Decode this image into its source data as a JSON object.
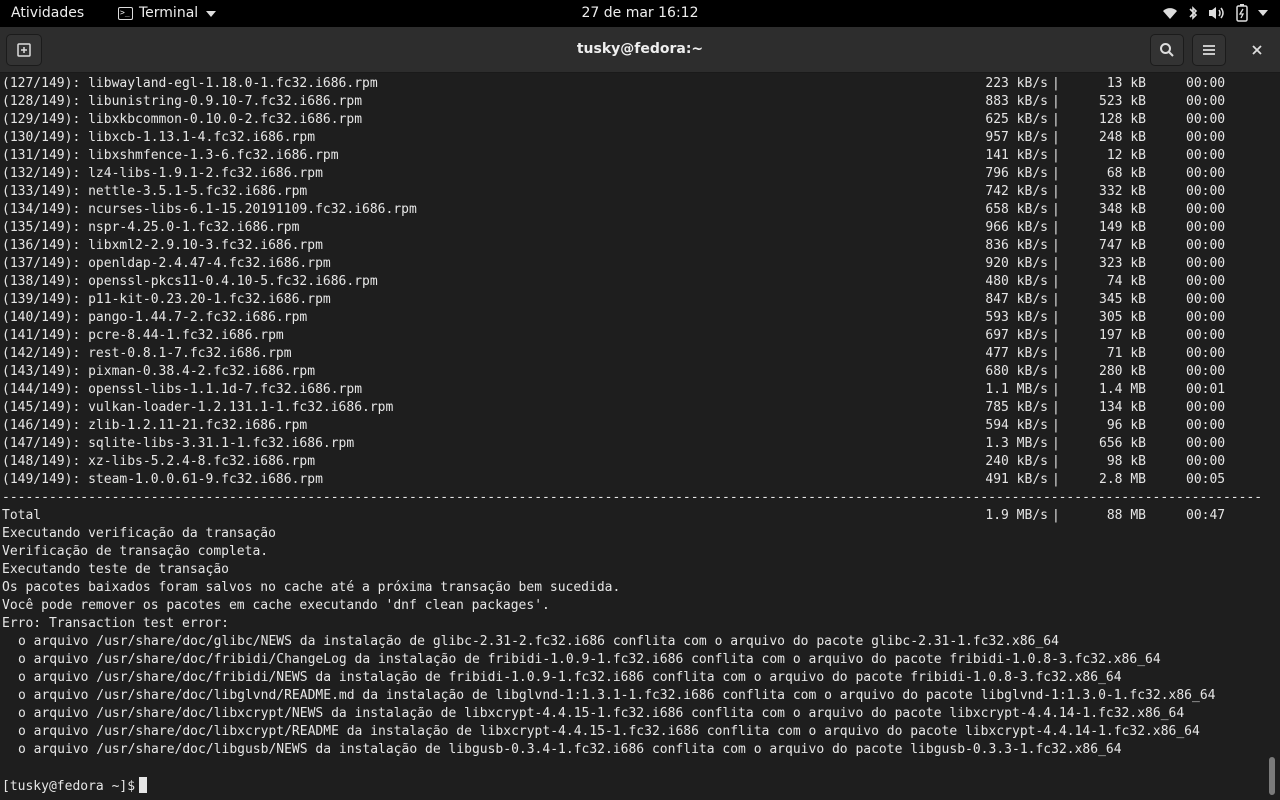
{
  "topbar": {
    "activities": "Atividades",
    "app_name": "Terminal",
    "clock": "27 de mar  16:12",
    "status_icons": [
      "wifi-icon",
      "bluetooth-icon",
      "volume-icon",
      "battery-icon",
      "power-caret-icon"
    ]
  },
  "window": {
    "title": "tusky@fedora:~",
    "buttons": [
      "new-tab-icon",
      "search-icon",
      "hamburger-menu-icon",
      "close-icon"
    ]
  },
  "downloads": [
    {
      "name": "(127/149): libwayland-egl-1.18.0-1.fc32.i686.rpm",
      "speed": "223 kB/s",
      "size": "13 kB",
      "time": "00:00"
    },
    {
      "name": "(128/149): libunistring-0.9.10-7.fc32.i686.rpm",
      "speed": "883 kB/s",
      "size": "523 kB",
      "time": "00:00"
    },
    {
      "name": "(129/149): libxkbcommon-0.10.0-2.fc32.i686.rpm",
      "speed": "625 kB/s",
      "size": "128 kB",
      "time": "00:00"
    },
    {
      "name": "(130/149): libxcb-1.13.1-4.fc32.i686.rpm",
      "speed": "957 kB/s",
      "size": "248 kB",
      "time": "00:00"
    },
    {
      "name": "(131/149): libxshmfence-1.3-6.fc32.i686.rpm",
      "speed": "141 kB/s",
      "size": "12 kB",
      "time": "00:00"
    },
    {
      "name": "(132/149): lz4-libs-1.9.1-2.fc32.i686.rpm",
      "speed": "796 kB/s",
      "size": "68 kB",
      "time": "00:00"
    },
    {
      "name": "(133/149): nettle-3.5.1-5.fc32.i686.rpm",
      "speed": "742 kB/s",
      "size": "332 kB",
      "time": "00:00"
    },
    {
      "name": "(134/149): ncurses-libs-6.1-15.20191109.fc32.i686.rpm",
      "speed": "658 kB/s",
      "size": "348 kB",
      "time": "00:00"
    },
    {
      "name": "(135/149): nspr-4.25.0-1.fc32.i686.rpm",
      "speed": "966 kB/s",
      "size": "149 kB",
      "time": "00:00"
    },
    {
      "name": "(136/149): libxml2-2.9.10-3.fc32.i686.rpm",
      "speed": "836 kB/s",
      "size": "747 kB",
      "time": "00:00"
    },
    {
      "name": "(137/149): openldap-2.4.47-4.fc32.i686.rpm",
      "speed": "920 kB/s",
      "size": "323 kB",
      "time": "00:00"
    },
    {
      "name": "(138/149): openssl-pkcs11-0.4.10-5.fc32.i686.rpm",
      "speed": "480 kB/s",
      "size": "74 kB",
      "time": "00:00"
    },
    {
      "name": "(139/149): p11-kit-0.23.20-1.fc32.i686.rpm",
      "speed": "847 kB/s",
      "size": "345 kB",
      "time": "00:00"
    },
    {
      "name": "(140/149): pango-1.44.7-2.fc32.i686.rpm",
      "speed": "593 kB/s",
      "size": "305 kB",
      "time": "00:00"
    },
    {
      "name": "(141/149): pcre-8.44-1.fc32.i686.rpm",
      "speed": "697 kB/s",
      "size": "197 kB",
      "time": "00:00"
    },
    {
      "name": "(142/149): rest-0.8.1-7.fc32.i686.rpm",
      "speed": "477 kB/s",
      "size": "71 kB",
      "time": "00:00"
    },
    {
      "name": "(143/149): pixman-0.38.4-2.fc32.i686.rpm",
      "speed": "680 kB/s",
      "size": "280 kB",
      "time": "00:00"
    },
    {
      "name": "(144/149): openssl-libs-1.1.1d-7.fc32.i686.rpm",
      "speed": "1.1 MB/s",
      "size": "1.4 MB",
      "time": "00:01"
    },
    {
      "name": "(145/149): vulkan-loader-1.2.131.1-1.fc32.i686.rpm",
      "speed": "785 kB/s",
      "size": "134 kB",
      "time": "00:00"
    },
    {
      "name": "(146/149): zlib-1.2.11-21.fc32.i686.rpm",
      "speed": "594 kB/s",
      "size": "96 kB",
      "time": "00:00"
    },
    {
      "name": "(147/149): sqlite-libs-3.31.1-1.fc32.i686.rpm",
      "speed": "1.3 MB/s",
      "size": "656 kB",
      "time": "00:00"
    },
    {
      "name": "(148/149): xz-libs-5.2.4-8.fc32.i686.rpm",
      "speed": "240 kB/s",
      "size": "98 kB",
      "time": "00:00"
    },
    {
      "name": "(149/149): steam-1.0.0.61-9.fc32.i686.rpm",
      "speed": "491 kB/s",
      "size": "2.8 MB",
      "time": "00:05"
    }
  ],
  "total": {
    "name": "Total",
    "speed": "1.9 MB/s",
    "size": "88 MB",
    "time": "00:47"
  },
  "messages": [
    "Executando verificação da transação",
    "Verificação de transação completa.",
    "Executando teste de transação",
    "Os pacotes baixados foram salvos no cache até a próxima transação bem sucedida.",
    "Você pode remover os pacotes em cache executando 'dnf clean packages'.",
    "Erro: Transaction test error:"
  ],
  "errors": [
    "o arquivo /usr/share/doc/glibc/NEWS da instalação de glibc-2.31-2.fc32.i686 conflita com o arquivo do pacote glibc-2.31-1.fc32.x86_64",
    "o arquivo /usr/share/doc/fribidi/ChangeLog da instalação de fribidi-1.0.9-1.fc32.i686 conflita com o arquivo do pacote fribidi-1.0.8-3.fc32.x86_64",
    "o arquivo /usr/share/doc/fribidi/NEWS da instalação de fribidi-1.0.9-1.fc32.i686 conflita com o arquivo do pacote fribidi-1.0.8-3.fc32.x86_64",
    "o arquivo /usr/share/doc/libglvnd/README.md da instalação de libglvnd-1:1.3.1-1.fc32.i686 conflita com o arquivo do pacote libglvnd-1:1.3.0-1.fc32.x86_64",
    "o arquivo /usr/share/doc/libxcrypt/NEWS da instalação de libxcrypt-4.4.15-1.fc32.i686 conflita com o arquivo do pacote libxcrypt-4.4.14-1.fc32.x86_64",
    "o arquivo /usr/share/doc/libxcrypt/README da instalação de libxcrypt-4.4.15-1.fc32.i686 conflita com o arquivo do pacote libxcrypt-4.4.14-1.fc32.x86_64",
    "o arquivo /usr/share/doc/libgusb/NEWS da instalação de libgusb-0.3.4-1.fc32.i686 conflita com o arquivo do pacote libgusb-0.3.3-1.fc32.x86_64"
  ],
  "prompt": "[tusky@fedora ~]$"
}
